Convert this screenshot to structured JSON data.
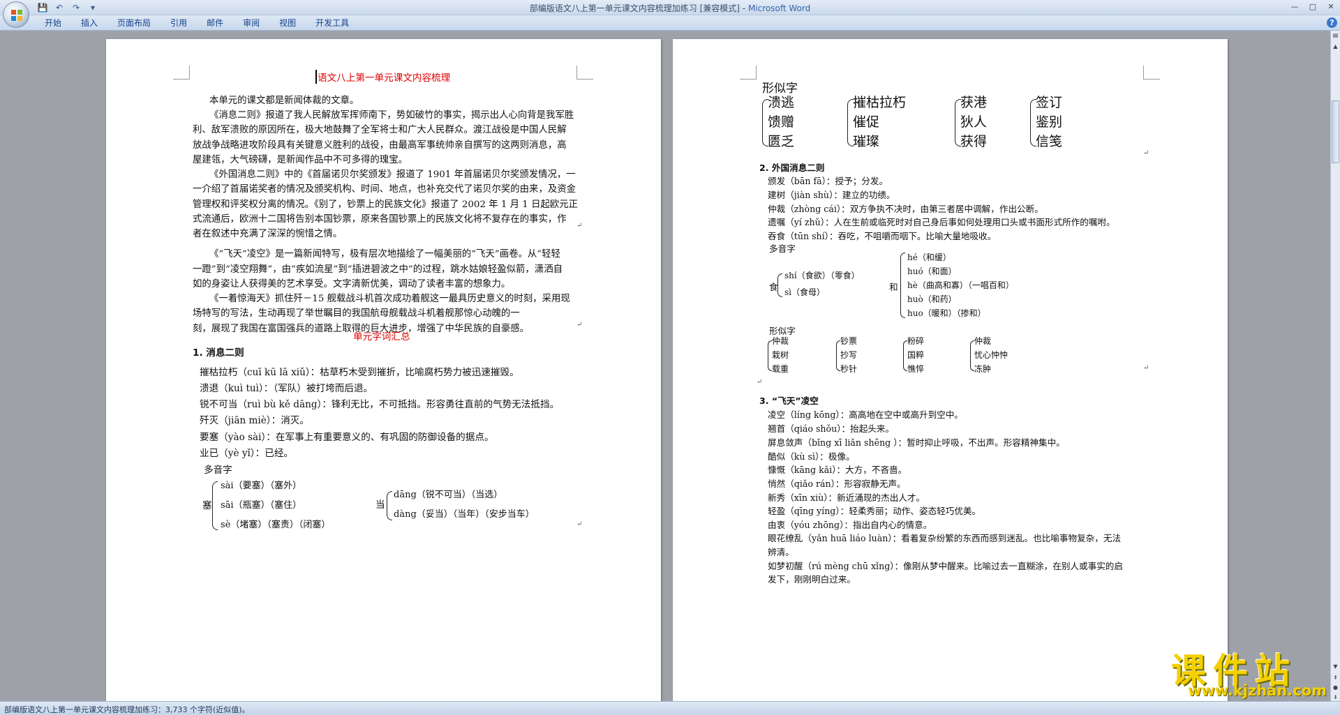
{
  "window": {
    "title": "部编版语文八上第一单元课文内容梳理加练习 [兼容模式]",
    "separator": " - ",
    "app": "Microsoft Word"
  },
  "qat": {
    "save": "💾",
    "undo": "↶",
    "redo": "↷",
    "more": "▾"
  },
  "winctrl": {
    "minimize": "—",
    "maximize": "□",
    "close": "✕"
  },
  "ribbon": {
    "tabs": [
      "开始",
      "插入",
      "页面布局",
      "引用",
      "邮件",
      "审阅",
      "视图",
      "开发工具"
    ],
    "help": "?"
  },
  "page1": {
    "title": "语文八上第一单元课文内容梳理",
    "lines": [
      "本单元的课文都是新闻体裁的文章。",
      "《消息二则》报道了我人民解放军挥师南下，势如破竹的事实，揭示出人心向背是我军胜",
      "利、敌军溃败的原因所在，极大地鼓舞了全军将士和广大人民群众。渡江战役是中国人民解",
      "放战争战略进攻阶段具有关键意义胜利的战役，由最高军事统帅亲自撰写的这两则消息，高",
      "屋建瓴，大气磅礴，是新闻作品中不可多得的瑰宝。",
      "《外国消息二则》中的《首届诺贝尔奖颁发》报道了 1901 年首届诺贝尔奖颁发情况，一",
      "一介绍了首届诺奖者的情况及颁奖机构、时间、地点，也补充交代了诺贝尔奖的由来，及资金",
      "管理权和评奖权分离的情况。《别了，钞票上的民族文化》报道了 2002 年 1 月 1 日起欧元正",
      "式流通后，欧洲十二国将告别本国钞票，原来各国钞票上的民族文化将不复存在的事实，作",
      "者在叙述中充满了深深的惋惜之情。",
      "《“飞天”凌空》是一篇新闻特写，极有层次地描绘了一幅美丽的“飞天”画卷。从“轻轻",
      "一蹬”到“凌空翔舞”，由“疾如流星”到“插进碧波之中”的过程，跳水姑娘轻盈似箭，潇洒自",
      "如的身姿让人获得美的艺术享受。文字清新优美，调动了读者丰富的想象力。",
      "《一着惊海天》抓住歼－15 舰载战斗机首次成功着舰这一最具历史意义的时刻，采用现",
      "场特写的写法，生动再现了举世瞩目的我国航母舰载战斗机着舰那惊心动魄的一",
      "刻，展现了我国在富国强兵的道路上取得的巨大进步，增强了中华民族的自豪感。"
    ],
    "section_title": "单元字词汇总",
    "h1": "1. 消息二则",
    "words": [
      "摧枯拉朽（cuī kū lā xiǔ）：枯草朽木受到摧折，比喻腐朽势力被迅速摧毁。",
      "溃退（kuì tuì）：（军队）被打垮而后退。",
      "锐不可当（ruì bù kě dāng）：锋利无比，不可抵挡。形容勇往直前的气势无法抵挡。",
      "歼灭（jiān miè）：消灭。",
      "要塞（yào sài）：在军事上有重要意义的、有巩固的防御设备的据点。",
      "业已（yè yǐ）：已经。"
    ],
    "poly_label": "多音字",
    "sai_head": "塞",
    "sai_items": [
      "sài（要塞）（塞外）",
      "sāi（瓶塞）（塞住）",
      "sè（堵塞）（塞责）（闭塞）"
    ],
    "dang_head": "当",
    "dang_items": [
      "dāng（锐不可当）（当选）",
      "dàng（妥当）（当年）（安步当车）"
    ],
    "pilcrow": "↵"
  },
  "page2": {
    "xingsi_title": "形似字",
    "big_groups": [
      [
        "溃逃",
        "馈赠",
        "匮乏"
      ],
      [
        "摧枯拉朽",
        "催促",
        "璀璨"
      ],
      [
        "获港",
        "狄人",
        "获得"
      ],
      [
        "签订",
        "鉴别",
        "信笺"
      ]
    ],
    "h2": "2. 外国消息二则",
    "words2": [
      "颁发（bān fā）：授予；分发。",
      "建树（jiàn shù）：建立的功绩。",
      "仲裁（zhòng cái）：双方争执不决时，由第三者居中调解，作出公断。",
      "遗嘱（yí zhǔ）：人在生前或临死时对自己身后事如何处理用口头或书面形式所作的嘱咐。",
      "吞食（tūn shí）：吞吃，不咀嚼而咽下。比喻大量地吸收。"
    ],
    "poly_label2": "多音字",
    "shi_head": "食",
    "shi_items": [
      "shí（食欲）（零食）",
      "sì（食母）"
    ],
    "he_head": "和",
    "he_items": [
      "hé（和缓）",
      "huó（和面）",
      "hè（曲高和寡）（一唱百和）",
      "huò（和药）",
      "huo（暖和）（掺和）"
    ],
    "xingsi2_label": "形似字",
    "small_groups": [
      [
        "仲裁",
        "栽树",
        "载重"
      ],
      [
        "钞票",
        "抄写",
        "秒针"
      ],
      [
        "粉碎",
        "国粹",
        "憔悴"
      ],
      [
        "仲裁",
        "忧心忡忡",
        "冻肿"
      ]
    ],
    "h3": "3. “飞天”凌空",
    "words3": [
      "凌空（líng kōng）：高高地在空中或高升到空中。",
      "翘首（qiáo shǒu）：抬起头来。",
      "屏息敛声（bǐng xī liǎn shēng ）：暂时抑止呼吸，不出声。形容精神集中。",
      "酷似（kù sì）：极像。",
      "慷慨（kāng kǎi）：大方，不吝啬。",
      "悄然（qiǎo rán）：形容寂静无声。",
      "新秀（xīn xiù）：新近涌现的杰出人才。",
      "轻盈（qīng yíng）：轻柔秀丽；动作、姿态轻巧优美。",
      "由衷（yóu zhōng）：指出自内心的情意。",
      "眼花缭乱（yǎn huā liáo luàn）：看着复杂纷繁的东西而感到迷乱。也比喻事物复杂，无法",
      "辨清。",
      "如梦初醒（rú mèng chū xǐng）：像刚从梦中醒来。比喻过去一直糊涂，在别人或事实的启",
      "发下，刚刚明白过来。"
    ],
    "pilcrow": "↵"
  },
  "status": {
    "text": "部编版语文八上第一单元课文内容梳理加练习：3,733 个字符(近似值)。"
  },
  "watermark": {
    "title": "课件站",
    "url": "www.kjzhan.com"
  },
  "colors": {
    "accent": "#15428b",
    "red": "#e00000",
    "watermark": "#f4d000"
  }
}
